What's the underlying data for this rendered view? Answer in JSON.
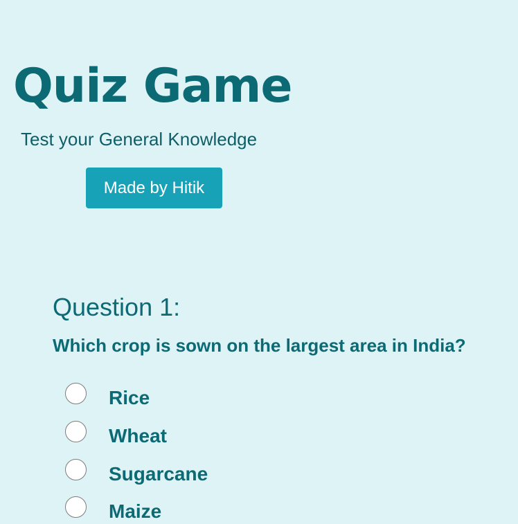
{
  "header": {
    "title": "Quiz Game",
    "subtitle": "Test your General Knowledge",
    "credit_button_label": "Made by Hitik"
  },
  "question": {
    "heading": "Question 1:",
    "text": "Which crop is sown on the largest area in India?",
    "options": [
      {
        "label": "Rice",
        "selected": false
      },
      {
        "label": "Wheat",
        "selected": false
      },
      {
        "label": "Sugarcane",
        "selected": false
      },
      {
        "label": "Maize",
        "selected": false
      }
    ]
  },
  "colors": {
    "background": "#def3f6",
    "heading_teal": "#0b6a74",
    "button_bg": "#17a2b8",
    "button_text": "#ffffff"
  }
}
